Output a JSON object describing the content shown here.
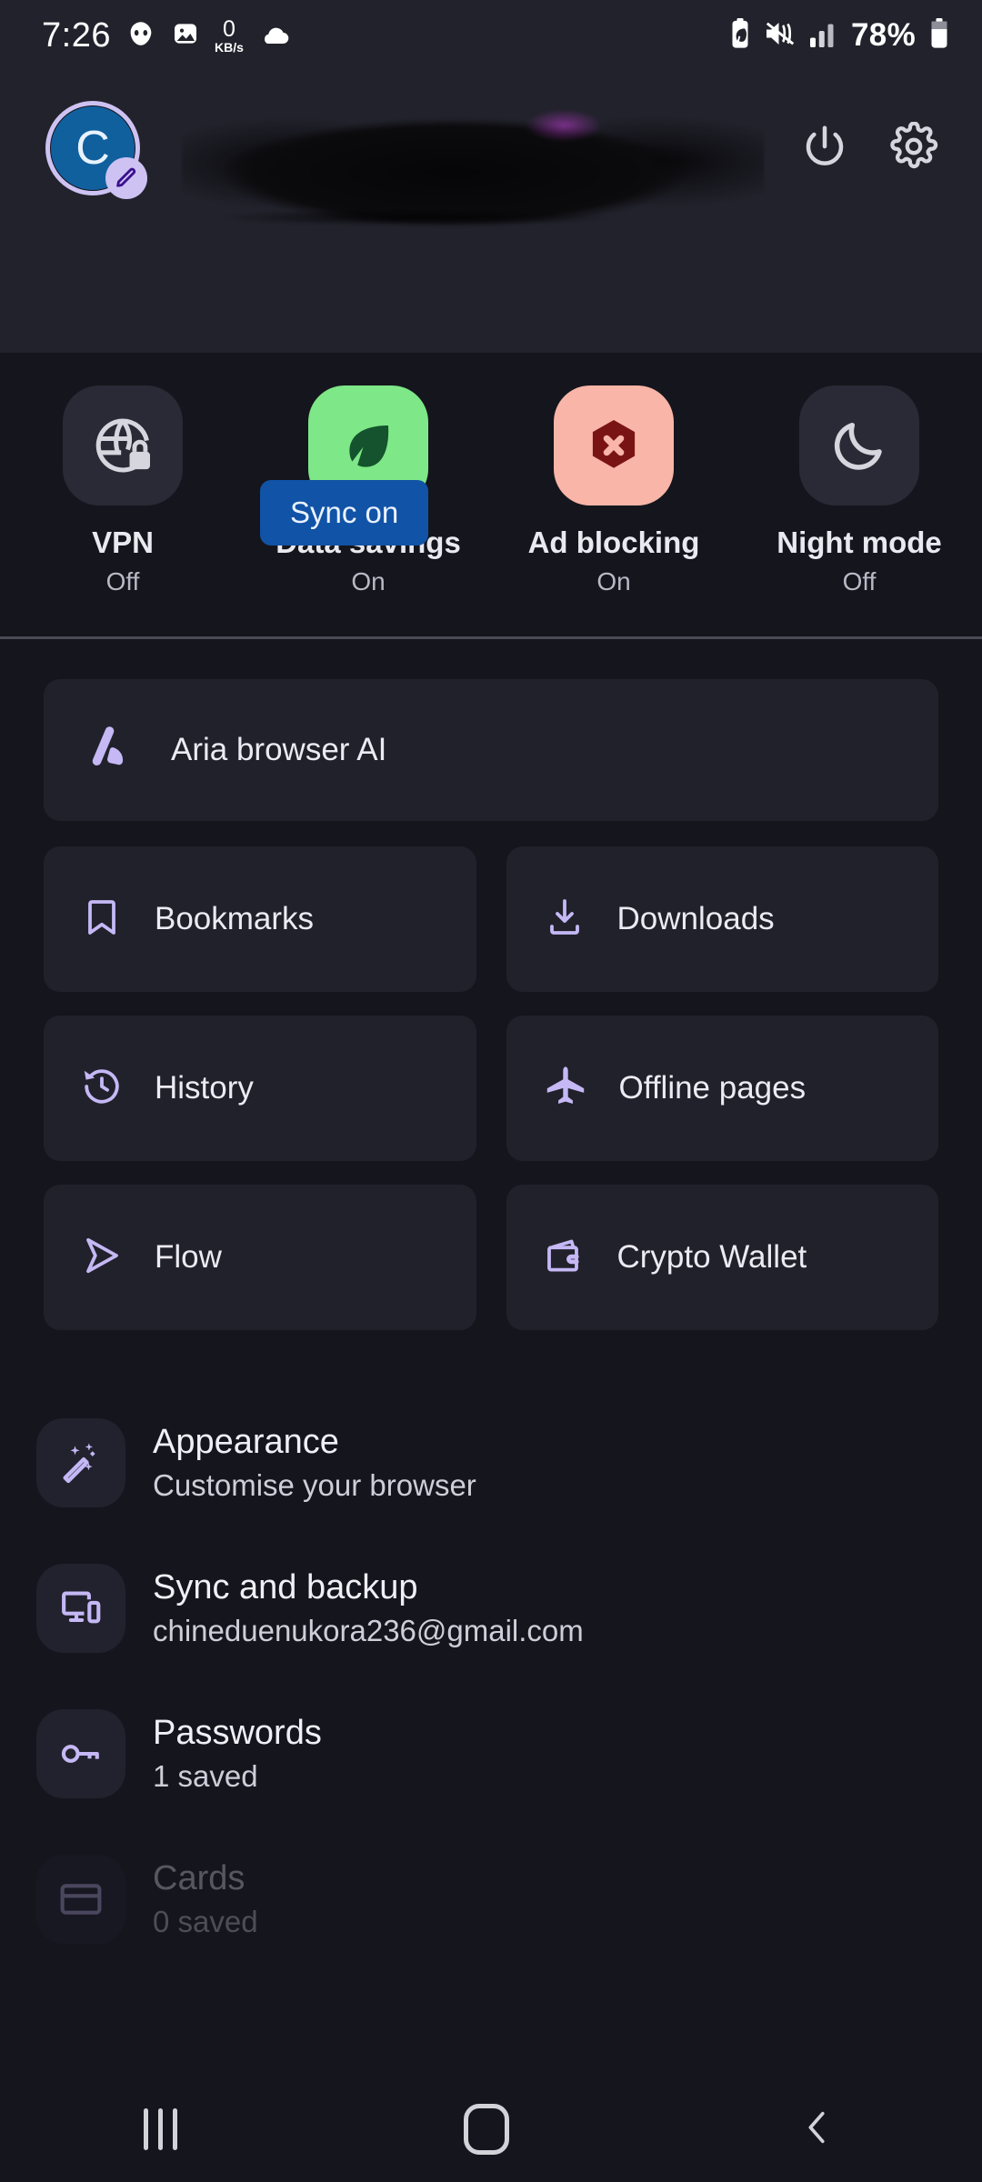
{
  "statusbar": {
    "time": "7:26",
    "icons_left": [
      "malwarebytes-icon",
      "screenshot-icon",
      "network-speed-icon",
      "weather-cloud-icon"
    ],
    "network_speed_value": "0",
    "network_speed_unit": "KB/s",
    "icons_right": [
      "battery-saver-icon",
      "mute-vibrate-icon",
      "signal-bars-icon"
    ],
    "battery_percent": "78%"
  },
  "header": {
    "avatar_initial": "C",
    "account_name_redacted": "",
    "sync_button_label": "Sync on",
    "power_icon": "power-icon",
    "settings_icon": "gear-icon",
    "edit_icon": "pencil-icon"
  },
  "toggles": [
    {
      "label": "VPN",
      "state": "Off",
      "icon": "globe-lock-icon",
      "active": false,
      "bg": "#2a2a36",
      "fg": "#d6d6de"
    },
    {
      "label": "Data savings",
      "state": "On",
      "icon": "leaf-icon",
      "active": true,
      "bg": "#7ee787",
      "fg": "#14532d"
    },
    {
      "label": "Ad blocking",
      "state": "On",
      "icon": "hexagon-x-icon",
      "active": true,
      "bg": "#f9b5a8",
      "fg": "#7a1414"
    },
    {
      "label": "Night mode",
      "state": "Off",
      "icon": "moon-icon",
      "active": false,
      "bg": "#2a2a36",
      "fg": "#d6d6de"
    }
  ],
  "aria": {
    "label": "Aria browser AI",
    "icon": "aria-logo-icon"
  },
  "tiles": [
    {
      "label": "Bookmarks",
      "icon": "bookmark-icon"
    },
    {
      "label": "Downloads",
      "icon": "download-icon"
    },
    {
      "label": "History",
      "icon": "history-clock-icon"
    },
    {
      "label": "Offline pages",
      "icon": "airplane-icon"
    },
    {
      "label": "Flow",
      "icon": "flow-send-icon"
    },
    {
      "label": "Crypto Wallet",
      "icon": "wallet-icon"
    }
  ],
  "settings": [
    {
      "title": "Appearance",
      "subtitle": "Customise your browser",
      "icon": "magic-wand-icon"
    },
    {
      "title": "Sync and backup",
      "subtitle": "chineduenukora236@gmail.com",
      "icon": "devices-sync-icon"
    },
    {
      "title": "Passwords",
      "subtitle": "1 saved",
      "icon": "key-icon"
    },
    {
      "title": "Cards",
      "subtitle": "0 saved",
      "icon": "credit-card-icon"
    }
  ],
  "navbar": {
    "recents": "recents-icon",
    "home": "home-icon",
    "back": "back-chevron-icon"
  },
  "colors": {
    "page_bg": "#15151d",
    "header_bg": "#22222c",
    "card_bg": "#21212b",
    "accent_purple": "#c5b8f5",
    "sync_blue": "#1153a6",
    "avatar_blue": "#10609e"
  }
}
